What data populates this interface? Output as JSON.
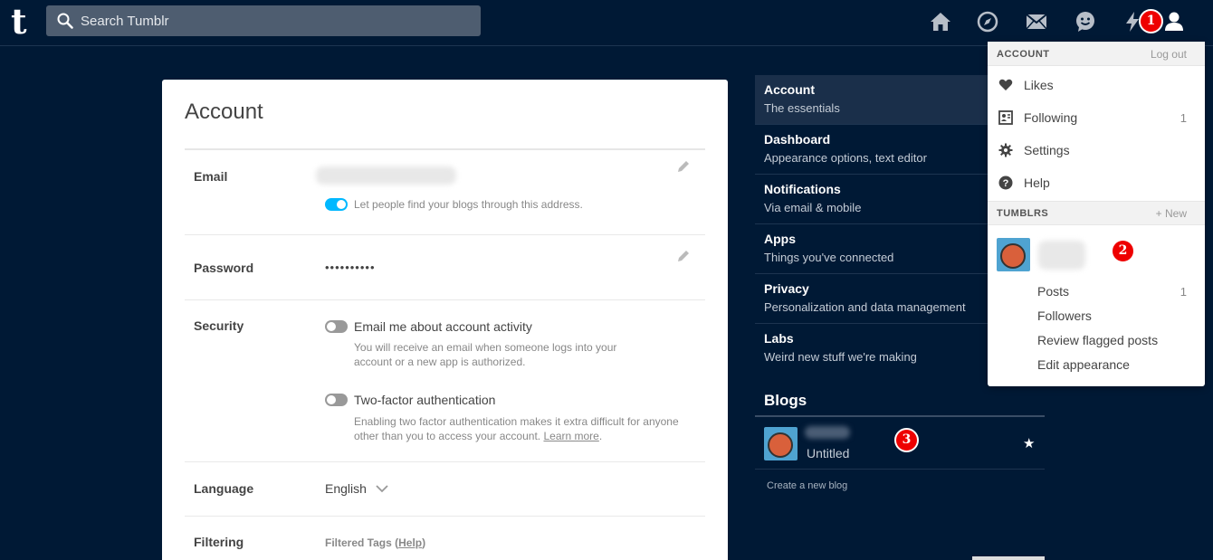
{
  "app": {
    "logo": "t",
    "search_placeholder": "Search Tumblr"
  },
  "nav_icons": [
    "home-icon",
    "explore-icon",
    "mail-icon",
    "chat-icon",
    "activity-icon",
    "account-icon"
  ],
  "annotations": {
    "badge1": "1",
    "badge2": "2",
    "badge3": "3"
  },
  "account": {
    "title": "Account",
    "email_label": "Email",
    "email_toggle_text": "Let people find your blogs through this address.",
    "password_label": "Password",
    "password_value": "••••••••••",
    "security_label": "Security",
    "security_opt1": "Email me about account activity",
    "security_opt1_desc1": "You will receive an email when someone logs into your",
    "security_opt1_desc2": "account or a new app is authorized.",
    "security_opt2": "Two-factor authentication",
    "security_opt2_desc1": "Enabling two factor authentication makes it extra difficult for anyone",
    "security_opt2_desc2_pre": "other than you to access your account. ",
    "security_opt2_link": "Learn more",
    "security_opt2_desc2_post": ".",
    "language_label": "Language",
    "language_value": "English",
    "filtering_label": "Filtering",
    "filtered_tags": "Filtered Tags (",
    "filtered_help": "Help",
    "filtered_close": ")"
  },
  "sidenav": {
    "items": [
      {
        "title": "Account",
        "sub": "The essentials"
      },
      {
        "title": "Dashboard",
        "sub": "Appearance options, text editor"
      },
      {
        "title": "Notifications",
        "sub": "Via email & mobile"
      },
      {
        "title": "Apps",
        "sub": "Things you've connected"
      },
      {
        "title": "Privacy",
        "sub": "Personalization and data management"
      },
      {
        "title": "Labs",
        "sub": "Weird new stuff we're making"
      }
    ],
    "blogs_heading": "Blogs",
    "blog_title": "Untitled",
    "create_blog": "Create a new blog"
  },
  "dropdown": {
    "account_header": "ACCOUNT",
    "logout": "Log out",
    "items": [
      {
        "label": "Likes",
        "count": ""
      },
      {
        "label": "Following",
        "count": "1"
      },
      {
        "label": "Settings",
        "count": ""
      },
      {
        "label": "Help",
        "count": ""
      }
    ],
    "tumblrs_header": "TUMBLRS",
    "new": "+ New",
    "blog_subitems": [
      {
        "label": "Posts",
        "count": "1"
      },
      {
        "label": "Followers",
        "count": ""
      },
      {
        "label": "Review flagged posts",
        "count": ""
      },
      {
        "label": "Edit appearance",
        "count": ""
      }
    ]
  }
}
